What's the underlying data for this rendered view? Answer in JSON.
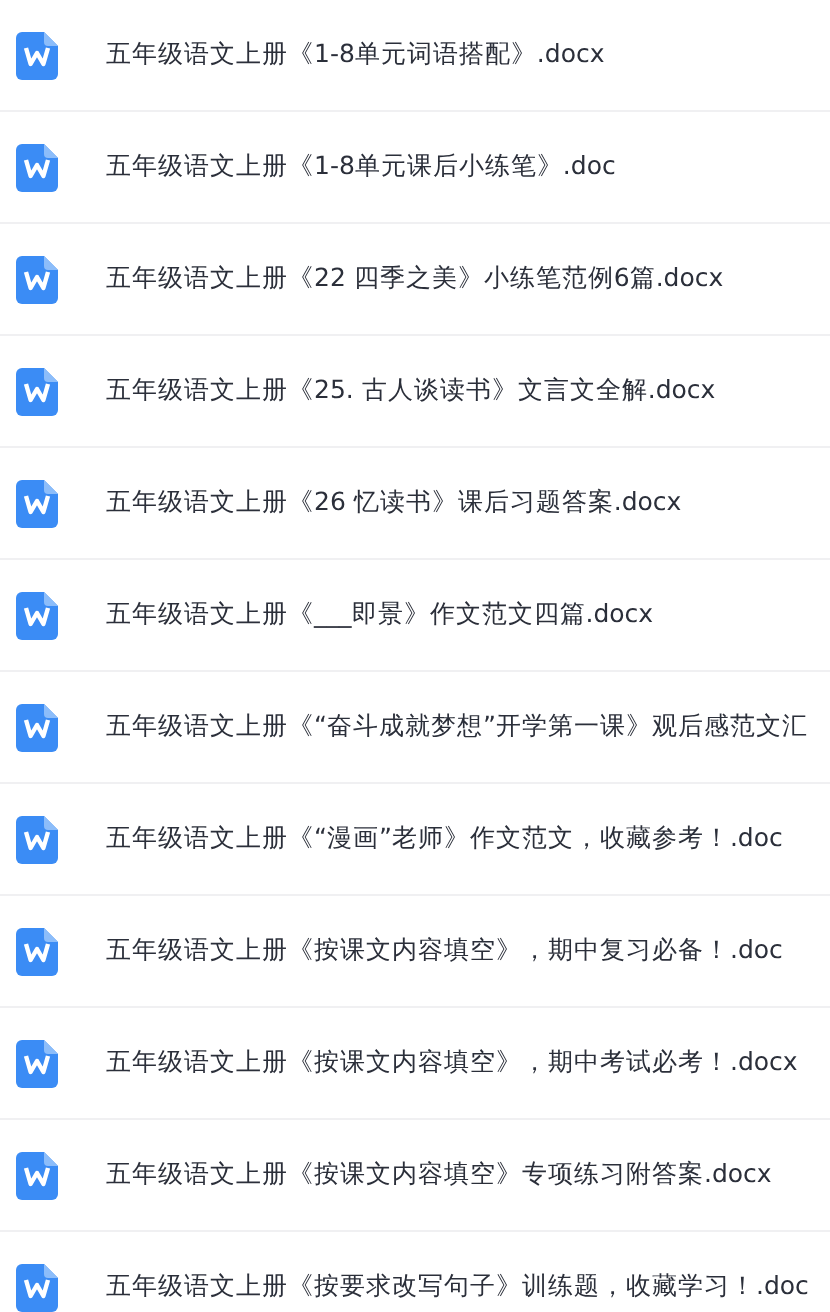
{
  "files": [
    {
      "name": "五年级语文上册《1-8单元词语搭配》.docx"
    },
    {
      "name": "五年级语文上册《1-8单元课后小练笔》.doc"
    },
    {
      "name": "五年级语文上册《22 四季之美》小练笔范例6篇.docx"
    },
    {
      "name": "五年级语文上册《25. 古人谈读书》文言文全解.docx"
    },
    {
      "name": "五年级语文上册《26 忆读书》课后习题答案.docx"
    },
    {
      "name": "五年级语文上册《___即景》作文范文四篇.docx"
    },
    {
      "name": "五年级语文上册《“奋斗成就梦想”开学第一课》观后感范文汇"
    },
    {
      "name": "五年级语文上册《“漫画”老师》作文范文，收藏参考！.doc"
    },
    {
      "name": "五年级语文上册《按课文内容填空》，期中复习必备！.doc"
    },
    {
      "name": "五年级语文上册《按课文内容填空》，期中考试必考！.docx"
    },
    {
      "name": "五年级语文上册《按课文内容填空》专项练习附答案.docx"
    },
    {
      "name": "五年级语文上册《按要求改写句子》训练题，收藏学习！.doc"
    }
  ]
}
